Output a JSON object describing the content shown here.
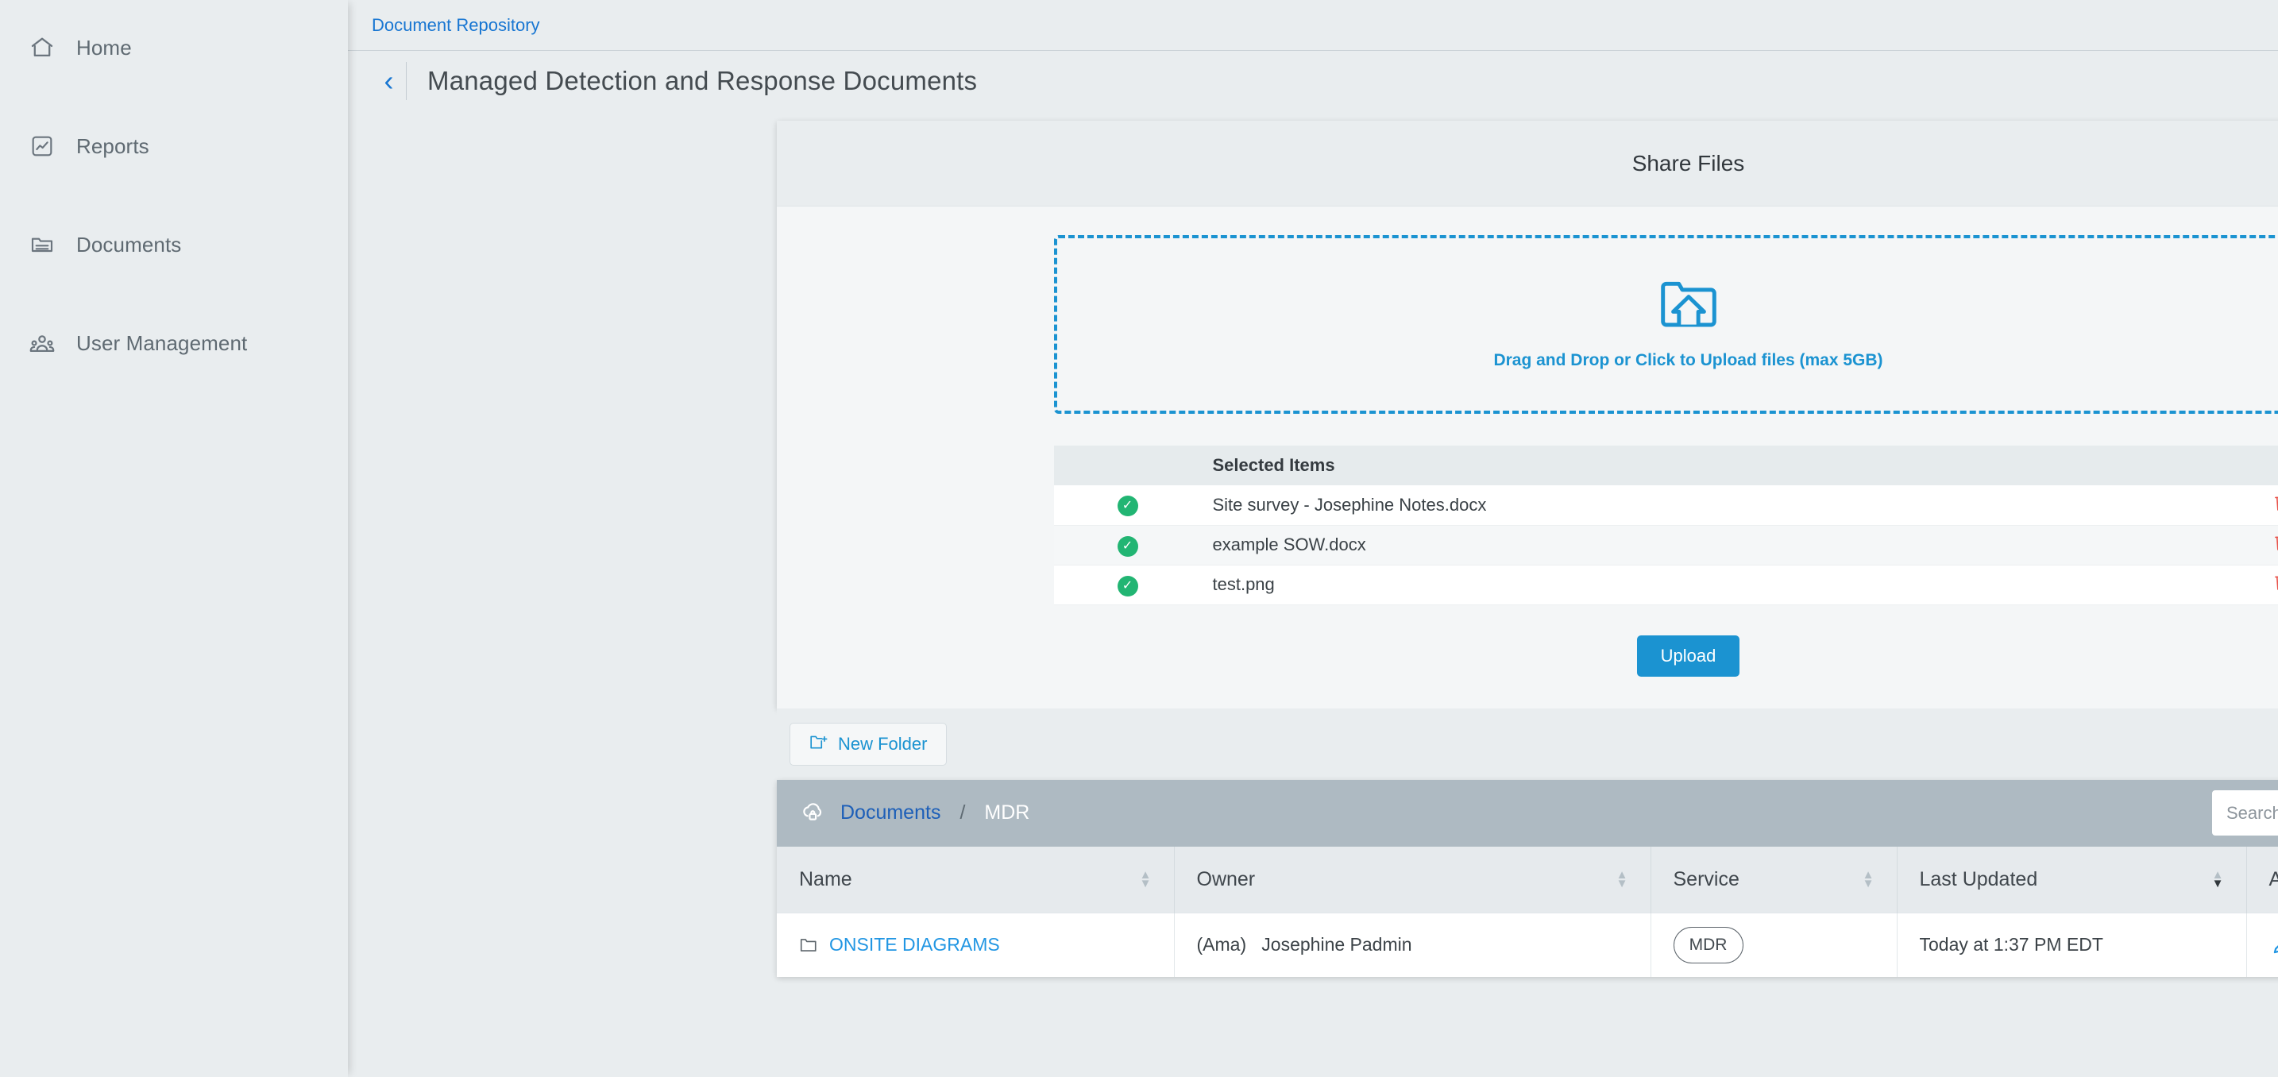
{
  "sidebar": {
    "items": [
      {
        "label": "Home",
        "icon": "home-icon"
      },
      {
        "label": "Reports",
        "icon": "chart-box-icon"
      },
      {
        "label": "Documents",
        "icon": "folder-lines-icon"
      },
      {
        "label": "User Management",
        "icon": "users-icon"
      }
    ]
  },
  "topbar": {
    "breadcrumb": "Document Repository"
  },
  "page": {
    "title": "Managed Detection and Response Documents",
    "back_glyph": "‹"
  },
  "share_panel": {
    "title": "Share Files",
    "dropzone": {
      "text": "Drag and Drop or Click to Upload files (max 5GB)",
      "icon": "folder-upload-icon"
    },
    "selected_table": {
      "headers": [
        "",
        "Selected Items",
        ""
      ],
      "rows": [
        {
          "checked": true,
          "name": "Site survey - Josephine Notes.docx",
          "delete_icon": "trash-icon"
        },
        {
          "checked": true,
          "name": "example SOW.docx",
          "delete_icon": "trash-icon"
        },
        {
          "checked": true,
          "name": "test.png",
          "delete_icon": "trash-icon"
        }
      ]
    },
    "upload_button": "Upload"
  },
  "folder_strip": {
    "new_folder_label": "New Folder",
    "new_folder_icon": "folder-plus-icon"
  },
  "doc_panel": {
    "breadcrumb": {
      "icon": "cloud-lock-icon",
      "root": "Documents",
      "separator": "/",
      "current": "MDR"
    },
    "search": {
      "placeholder": "Search...",
      "value": "",
      "icon": "search-icon"
    },
    "refresh_icon": "refresh-icon",
    "table": {
      "columns": [
        {
          "label": "Name",
          "sortable": true,
          "sort_state": "none"
        },
        {
          "label": "Owner",
          "sortable": true,
          "sort_state": "none"
        },
        {
          "label": "Service",
          "sortable": true,
          "sort_state": "none"
        },
        {
          "label": "Last Updated",
          "sortable": true,
          "sort_state": "desc"
        },
        {
          "label": "Actions",
          "sortable": false,
          "sort_state": "none"
        }
      ],
      "rows": [
        {
          "name": "ONSITE DIAGRAMS",
          "name_icon": "folder-icon",
          "owner_prefix": "(Ama)",
          "owner": "Josephine Padmin",
          "service": "MDR",
          "last_updated": "Today at 1:37 PM EDT",
          "actions": [
            "edit-icon",
            "move-icon",
            "delete-icon"
          ]
        }
      ]
    }
  },
  "colors": {
    "accent_blue": "#1b93d1",
    "link_blue": "#2196e3",
    "crumb_blue": "#1876d2",
    "success_green": "#22b573",
    "danger_red": "#e8524a",
    "bar_gray": "#aebac2",
    "page_bg": "#e9edef",
    "panel_bg": "#f4f6f7"
  }
}
